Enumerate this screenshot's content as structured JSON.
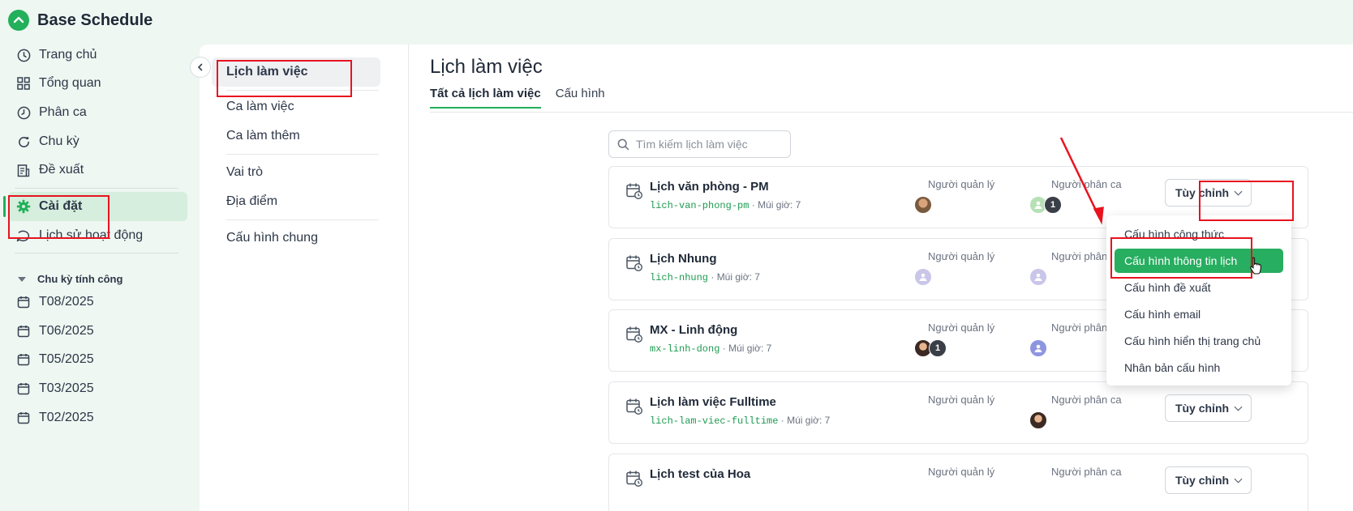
{
  "app": {
    "title": "Base Schedule"
  },
  "sidebar": {
    "items": [
      {
        "label": "Trang chủ",
        "icon": "clock-icon"
      },
      {
        "label": "Tổng quan",
        "icon": "grid-icon"
      },
      {
        "label": "Phân ca",
        "icon": "clock-icon"
      },
      {
        "label": "Chu kỳ",
        "icon": "refresh-icon"
      },
      {
        "label": "Đề xuất",
        "icon": "document-icon"
      },
      {
        "label": "Cài đặt",
        "icon": "gear-icon",
        "active": true
      },
      {
        "label": "Lịch sử hoạt động",
        "icon": "history-icon"
      }
    ],
    "section_title": "Chu kỳ tính công",
    "periods": [
      "T08/2025",
      "T06/2025",
      "T05/2025",
      "T03/2025",
      "T02/2025"
    ]
  },
  "subnav": {
    "items": [
      "Lịch làm việc",
      "Ca làm việc",
      "Ca làm thêm",
      "Vai trò",
      "Địa điểm",
      "Cấu hình chung"
    ],
    "active": "Lịch làm việc"
  },
  "main": {
    "title": "Lịch làm việc",
    "tabs": [
      {
        "label": "Tất cả lịch làm việc",
        "active": true
      },
      {
        "label": "Cấu hình",
        "active": false
      }
    ],
    "search_placeholder": "Tìm kiếm lịch làm việc",
    "manager_label": "Người quản lý",
    "assigner_label": "Người phân ca",
    "customize_label": "Tùy chỉnh",
    "cards": [
      {
        "title": "Lịch văn phòng - PM",
        "code": "lich-van-phong-pm",
        "tz": "· Múi giờ: 7",
        "assigner_count": "1",
        "manager_count": ""
      },
      {
        "title": "Lịch Nhung",
        "code": "lich-nhung",
        "tz": "· Múi giờ: 7",
        "assigner_count": "",
        "manager_count": "",
        "assigner_label_short": "Người phân"
      },
      {
        "title": "MX - Linh động",
        "code": "mx-linh-dong",
        "tz": "· Múi giờ: 7",
        "assigner_count": "",
        "manager_count": "1",
        "assigner_label_short": "Người phân"
      },
      {
        "title": "Lịch làm việc Fulltime",
        "code": "lich-lam-viec-fulltime",
        "tz": "· Múi giờ: 7",
        "assigner_count": "",
        "manager_count": ""
      },
      {
        "title": "Lịch test của Hoa",
        "code": "",
        "tz": "",
        "assigner_count": "",
        "manager_count": ""
      }
    ]
  },
  "dropdown": {
    "items": [
      "Cấu hình công thức",
      "Cấu hình thông tin lịch",
      "Cấu hình đề xuất",
      "Cấu hình email",
      "Cấu hình hiển thị trang chủ",
      "Nhân bản cấu hình"
    ],
    "highlighted": "Cấu hình thông tin lịch"
  },
  "colors": {
    "accent": "#22b05a",
    "annotation": "#e8131f",
    "highlight": "#27ae60"
  }
}
